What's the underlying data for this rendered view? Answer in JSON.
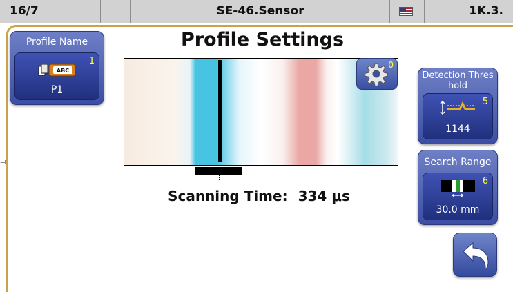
{
  "statusbar": {
    "position": "16/7",
    "device": "SE-46.Sensor",
    "language_icon": "us-flag-icon",
    "mode": "1K.3."
  },
  "page": {
    "title": "Profile Settings"
  },
  "profile_name": {
    "header": "Profile Name",
    "number": "1",
    "value": "P1",
    "icon": "abc-label-icon",
    "icon_text": "ABC"
  },
  "detection_threshold": {
    "header": "Detection Thres hold",
    "number": "5",
    "value": "1144",
    "icon": "threshold-icon"
  },
  "search_range": {
    "header": "Search Range",
    "number": "6",
    "value": "30.0 mm",
    "icon": "search-range-icon"
  },
  "settings": {
    "number": "0",
    "icon": "gear-icon"
  },
  "scan": {
    "label": "Scanning Time:",
    "value": "334 μs"
  },
  "back": {
    "icon": "back-arrow-icon"
  },
  "colors": {
    "tile_blue": "#3f52b3",
    "frame_gold": "#c9a24a",
    "accent_yellow": "#ffff33",
    "signal_cyan": "#48c4e3",
    "signal_red": "#eaa7a3"
  }
}
